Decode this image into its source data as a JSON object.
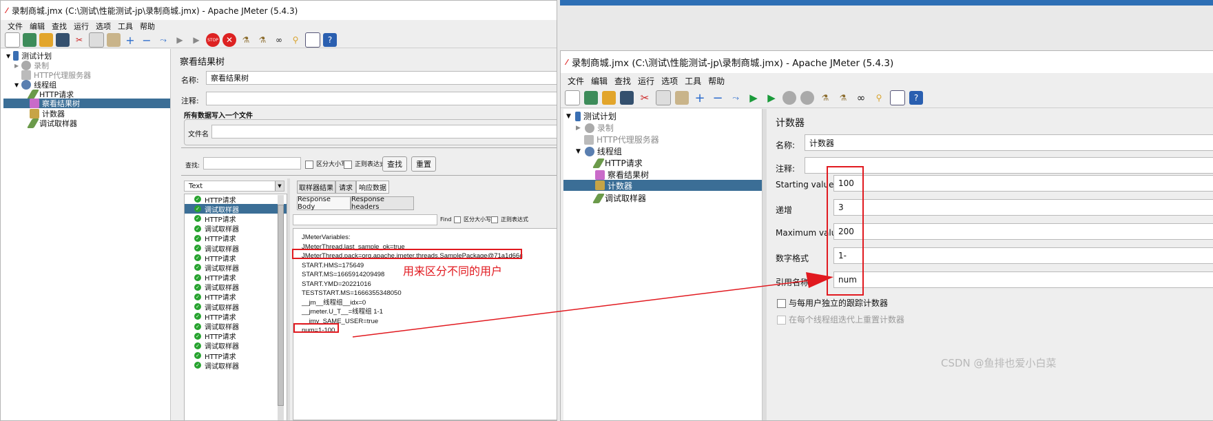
{
  "left_window": {
    "title": "录制商城.jmx (C:\\测试\\性能测试-jp\\录制商城.jmx) - Apache JMeter (5.4.3)",
    "menu": [
      "文件",
      "编辑",
      "查找",
      "运行",
      "选项",
      "工具",
      "帮助"
    ],
    "tree": [
      {
        "label": "测试计划",
        "icon": "test-plan-icon"
      },
      {
        "label": "录制",
        "icon": "gear-icon"
      },
      {
        "label": "HTTP代理服务器",
        "icon": "proxy-icon"
      },
      {
        "label": "线程组",
        "icon": "gear-icon"
      },
      {
        "label": "HTTP请求",
        "icon": "pipette-icon"
      },
      {
        "label": "察看结果树",
        "icon": "chart-icon"
      },
      {
        "label": "计数器",
        "icon": "tools-icon"
      },
      {
        "label": "调试取样器",
        "icon": "pipette-icon"
      }
    ],
    "panel": {
      "title": "察看结果树",
      "name_label": "名称:",
      "name_value": "察看结果树",
      "comment_label": "注释:",
      "write_all_label": "所有数据写入一个文件",
      "filename_label": "文件名",
      "search_label": "查找:",
      "case_label": "区分大小写",
      "regex_label": "正则表达式",
      "search_btn": "查找",
      "reset_btn": "重置",
      "renderer": "Text",
      "tabs": [
        "取样器结果",
        "请求",
        "响应数据"
      ],
      "subtabs": [
        "Response Body",
        "Response headers"
      ],
      "find_label": "Find",
      "find_case": "区分大小写",
      "find_regex": "正则表达式",
      "results": [
        "HTTP请求",
        "调试取样器",
        "HTTP请求",
        "调试取样器",
        "HTTP请求",
        "调试取样器",
        "HTTP请求",
        "调试取样器",
        "HTTP请求",
        "调试取样器",
        "HTTP请求",
        "调试取样器",
        "HTTP请求",
        "调试取样器",
        "HTTP请求",
        "调试取样器",
        "HTTP请求",
        "调试取样器"
      ],
      "response_lines": [
        "JMeterVariables:",
        "JMeterThread.last_sample_ok=true",
        "JMeterThread.pack=org.apache.jmeter.threads.SamplePackage@71a1d66c",
        "START.HMS=175649",
        "START.MS=1665914209498",
        "START.YMD=20221016",
        "TESTSTART.MS=1666355348050",
        "__jm__线程组__idx=0",
        "__jmeter.U_T__=线程组 1-1",
        "__jmv_SAME_USER=true",
        "num=1-100"
      ]
    }
  },
  "right_window": {
    "title": "录制商城.jmx (C:\\测试\\性能测试-jp\\录制商城.jmx) - Apache JMeter (5.4.3)",
    "menu": [
      "文件",
      "编辑",
      "查找",
      "运行",
      "选项",
      "工具",
      "帮助"
    ],
    "tree": [
      {
        "label": "测试计划",
        "icon": "test-plan-icon"
      },
      {
        "label": "录制",
        "icon": "gear-icon"
      },
      {
        "label": "HTTP代理服务器",
        "icon": "proxy-icon"
      },
      {
        "label": "线程组",
        "icon": "gear-icon"
      },
      {
        "label": "HTTP请求",
        "icon": "pipette-icon"
      },
      {
        "label": "察看结果树",
        "icon": "chart-icon"
      },
      {
        "label": "计数器",
        "icon": "tools-icon"
      },
      {
        "label": "调试取样器",
        "icon": "pipette-icon"
      }
    ],
    "panel": {
      "title": "计数器",
      "name_label": "名称:",
      "name_value": "计数器",
      "comment_label": "注释:",
      "fields": [
        {
          "label": "Starting value",
          "value": "100"
        },
        {
          "label": "递增",
          "value": "3"
        },
        {
          "label": "Maximum value",
          "value": "200"
        },
        {
          "label": "数字格式",
          "value": "1-"
        },
        {
          "label": "引用名称",
          "value": "num"
        }
      ],
      "per_user_label": "与每用户独立的跟踪计数器",
      "reset_label": "在每个线程组迭代上重置计数器"
    }
  },
  "annotation": {
    "text": "用来区分不同的用户",
    "color": "#e1191f"
  },
  "watermark": "CSDN @鱼排也爱小白菜",
  "colors": {
    "selection": "#3b6e96",
    "success": "#27a32f",
    "annotation": "#e1191f"
  }
}
